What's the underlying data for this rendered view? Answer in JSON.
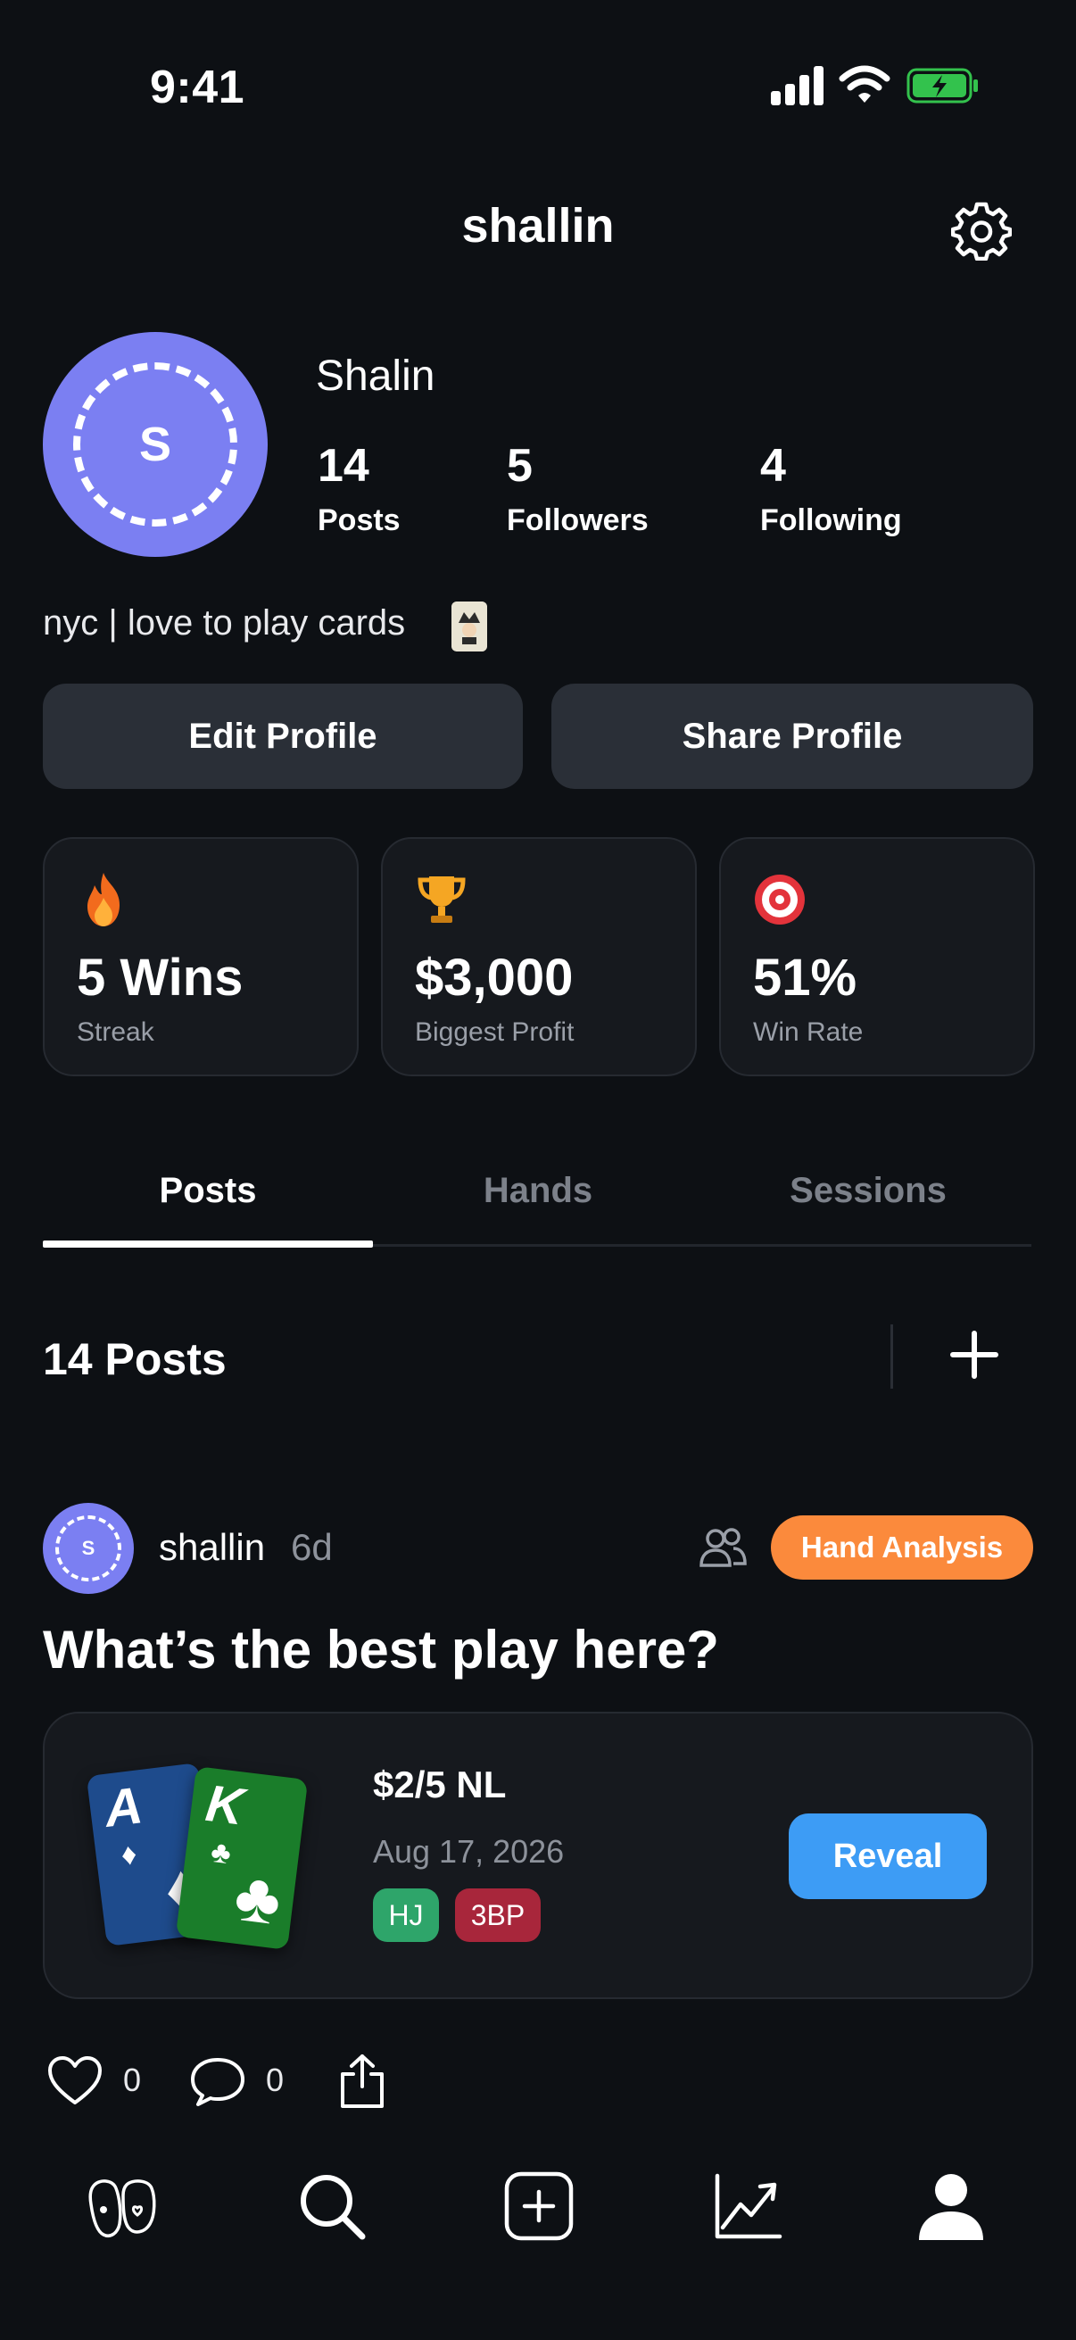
{
  "status_bar": {
    "time": "9:41"
  },
  "header": {
    "title": "shallin"
  },
  "profile": {
    "avatar_letter": "S",
    "display_name": "Shalin",
    "stats": [
      {
        "value": "14",
        "label": "Posts"
      },
      {
        "value": "5",
        "label": "Followers"
      },
      {
        "value": "4",
        "label": "Following"
      }
    ],
    "bio": "nyc | love to play cards"
  },
  "actions": {
    "edit_label": "Edit Profile",
    "share_label": "Share Profile"
  },
  "highlights": [
    {
      "icon": "fire-icon",
      "value": "5 Wins",
      "label": "Streak"
    },
    {
      "icon": "trophy-icon",
      "value": "$3,000",
      "label": "Biggest Profit"
    },
    {
      "icon": "target-icon",
      "value": "51%",
      "label": "Win Rate"
    }
  ],
  "tabs": [
    {
      "label": "Posts",
      "active": true
    },
    {
      "label": "Hands",
      "active": false
    },
    {
      "label": "Sessions",
      "active": false
    }
  ],
  "posts_section": {
    "count_label": "14 Posts"
  },
  "post": {
    "avatar_letter": "S",
    "username": "shallin",
    "age": "6d",
    "badge": "Hand Analysis",
    "title": "What’s the best play here?",
    "hand": {
      "cards": [
        {
          "rank": "A",
          "suit": "♦"
        },
        {
          "rank": "K",
          "suit": "♣"
        }
      ],
      "stakes": "$2/5 NL",
      "date": "Aug 17, 2026",
      "position": "HJ",
      "pot_type": "3BP",
      "reveal_label": "Reveal"
    },
    "likes": "0",
    "comments": "0"
  },
  "colors": {
    "background": "#0d1014",
    "accent_purple": "#7b7ff2",
    "badge_orange": "#fb8a3c",
    "reveal_blue": "#3d9cf5",
    "position_green": "#2ea56a",
    "pot_red": "#a8263b"
  }
}
